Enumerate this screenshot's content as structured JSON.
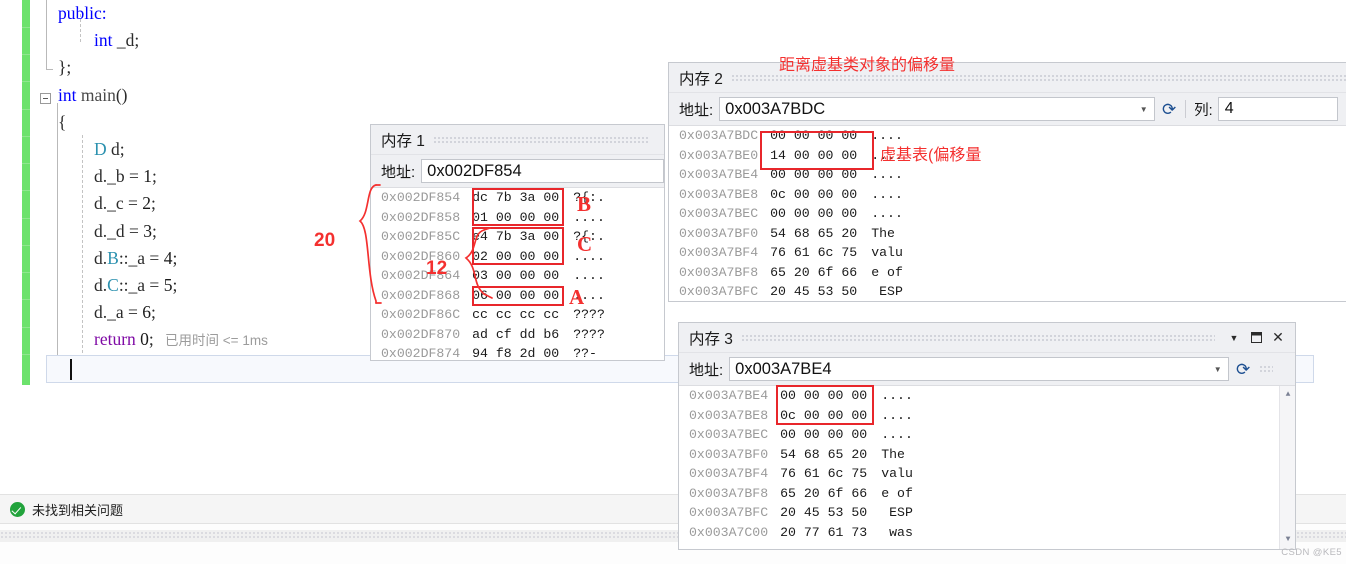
{
  "editor": {
    "lines": [
      {
        "indent": 0,
        "tokens": [
          {
            "t": "public:",
            "c": "kw"
          }
        ]
      },
      {
        "indent": 1,
        "tokens": [
          {
            "t": "int",
            "c": "kw"
          },
          {
            "t": " _d;",
            "c": "pln"
          }
        ]
      },
      {
        "indent": 0,
        "tokens": [
          {
            "t": "};",
            "c": "pln"
          }
        ]
      },
      {
        "indent": 0,
        "tokens": [
          {
            "t": "int",
            "c": "kw"
          },
          {
            "t": " ",
            "c": "pln"
          },
          {
            "t": "main",
            "c": "fn"
          },
          {
            "t": "()",
            "c": "pln"
          }
        ]
      },
      {
        "indent": 0,
        "tokens": [
          {
            "t": "{",
            "c": "pln"
          }
        ]
      },
      {
        "indent": 1,
        "tokens": [
          {
            "t": "D",
            "c": "typ"
          },
          {
            "t": " d;",
            "c": "pln"
          }
        ]
      },
      {
        "indent": 1,
        "tokens": [
          {
            "t": "d._b = ",
            "c": "pln"
          },
          {
            "t": "1",
            "c": "num"
          },
          {
            "t": ";",
            "c": "pln"
          }
        ]
      },
      {
        "indent": 1,
        "tokens": [
          {
            "t": "d._c = ",
            "c": "pln"
          },
          {
            "t": "2",
            "c": "num"
          },
          {
            "t": ";",
            "c": "pln"
          }
        ]
      },
      {
        "indent": 1,
        "tokens": [
          {
            "t": "d._d = ",
            "c": "pln"
          },
          {
            "t": "3",
            "c": "num"
          },
          {
            "t": ";",
            "c": "pln"
          }
        ]
      },
      {
        "indent": 1,
        "tokens": [
          {
            "t": "d.",
            "c": "pln"
          },
          {
            "t": "B",
            "c": "typ"
          },
          {
            "t": "::_a = ",
            "c": "pln"
          },
          {
            "t": "4",
            "c": "num"
          },
          {
            "t": ";",
            "c": "pln"
          }
        ]
      },
      {
        "indent": 1,
        "tokens": [
          {
            "t": "d.",
            "c": "pln"
          },
          {
            "t": "C",
            "c": "typ"
          },
          {
            "t": "::_a = ",
            "c": "pln"
          },
          {
            "t": "5",
            "c": "num"
          },
          {
            "t": ";",
            "c": "pln"
          }
        ]
      },
      {
        "indent": 1,
        "tokens": [
          {
            "t": "d._a = ",
            "c": "pln"
          },
          {
            "t": "6",
            "c": "num"
          },
          {
            "t": ";",
            "c": "pln"
          }
        ]
      },
      {
        "indent": 1,
        "tokens": [
          {
            "t": "return",
            "c": "kw2"
          },
          {
            "t": " ",
            "c": "pln"
          },
          {
            "t": "0",
            "c": "num"
          },
          {
            "t": ";",
            "c": "pln"
          }
        ],
        "hint": "已用时间 <= 1ms"
      },
      {
        "indent": 0,
        "tokens": [
          {
            "t": "}",
            "c": "pln"
          }
        ]
      }
    ]
  },
  "statusbar": {
    "icon": "check-circle-icon",
    "text": "未找到相关问题"
  },
  "mem1": {
    "title": "内存 1",
    "address_label": "地址:",
    "address_value": "0x002DF854",
    "rows": [
      {
        "addr": "0x002DF854",
        "hex": "dc 7b 3a 00",
        "ascii": "?{:."
      },
      {
        "addr": "0x002DF858",
        "hex": "01 00 00 00",
        "ascii": "...."
      },
      {
        "addr": "0x002DF85C",
        "hex": "e4 7b 3a 00",
        "ascii": "?{:."
      },
      {
        "addr": "0x002DF860",
        "hex": "02 00 00 00",
        "ascii": "...."
      },
      {
        "addr": "0x002DF864",
        "hex": "03 00 00 00",
        "ascii": "...."
      },
      {
        "addr": "0x002DF868",
        "hex": "06 00 00 00",
        "ascii": "...."
      },
      {
        "addr": "0x002DF86C",
        "hex": "cc cc cc cc",
        "ascii": "????"
      },
      {
        "addr": "0x002DF870",
        "hex": "ad cf dd b6",
        "ascii": "????"
      },
      {
        "addr": "0x002DF874",
        "hex": "94 f8 2d 00",
        "ascii": "??-"
      }
    ],
    "annotations": {
      "brace_20": "20",
      "brace_12": "12",
      "label_b": "B",
      "label_c": "C",
      "label_a": "A"
    }
  },
  "mem2": {
    "title": "内存 2",
    "address_label": "地址:",
    "address_value": "0x003A7BDC",
    "col_label": "列:",
    "col_value": "4",
    "rows": [
      {
        "addr": "0x003A7BDC",
        "hex": "00 00 00 00",
        "ascii": "...."
      },
      {
        "addr": "0x003A7BE0",
        "hex": "14 00 00 00",
        "ascii": "...."
      },
      {
        "addr": "0x003A7BE4",
        "hex": "00 00 00 00",
        "ascii": "...."
      },
      {
        "addr": "0x003A7BE8",
        "hex": "0c 00 00 00",
        "ascii": "...."
      },
      {
        "addr": "0x003A7BEC",
        "hex": "00 00 00 00",
        "ascii": "...."
      },
      {
        "addr": "0x003A7BF0",
        "hex": "54 68 65 20",
        "ascii": "The "
      },
      {
        "addr": "0x003A7BF4",
        "hex": "76 61 6c 75",
        "ascii": "valu"
      },
      {
        "addr": "0x003A7BF8",
        "hex": "65 20 6f 66",
        "ascii": "e of"
      },
      {
        "addr": "0x003A7BFC",
        "hex": "20 45 53 50",
        "ascii": " ESP"
      }
    ],
    "annotations": {
      "top_note": "距离虚基类对象的偏移量",
      "inline_note": "虚基表(偏移量"
    }
  },
  "mem3": {
    "title": "内存 3",
    "address_label": "地址:",
    "address_value": "0x003A7BE4",
    "rows": [
      {
        "addr": "0x003A7BE4",
        "hex": "00 00 00 00",
        "ascii": "...."
      },
      {
        "addr": "0x003A7BE8",
        "hex": "0c 00 00 00",
        "ascii": "...."
      },
      {
        "addr": "0x003A7BEC",
        "hex": "00 00 00 00",
        "ascii": "...."
      },
      {
        "addr": "0x003A7BF0",
        "hex": "54 68 65 20",
        "ascii": "The "
      },
      {
        "addr": "0x003A7BF4",
        "hex": "76 61 6c 75",
        "ascii": "valu"
      },
      {
        "addr": "0x003A7BF8",
        "hex": "65 20 6f 66",
        "ascii": "e of"
      },
      {
        "addr": "0x003A7BFC",
        "hex": "20 45 53 50",
        "ascii": " ESP"
      },
      {
        "addr": "0x003A7C00",
        "hex": "20 77 61 73",
        "ascii": " was"
      }
    ],
    "titlebar": {
      "dropdown_icon": "chevron-down-icon",
      "maximize_icon": "maximize-icon",
      "close_icon": "close-icon"
    }
  },
  "watermark": "CSDN @KE5",
  "colors": {
    "annotation_red": "#f4302f",
    "box_red": "#e8262b",
    "keyword_blue": "#0000ff",
    "type_teal": "#2b91af",
    "keyword_purple": "#7f0aa5",
    "change_bar_green": "#6ce26c",
    "status_green": "#22a33c"
  }
}
